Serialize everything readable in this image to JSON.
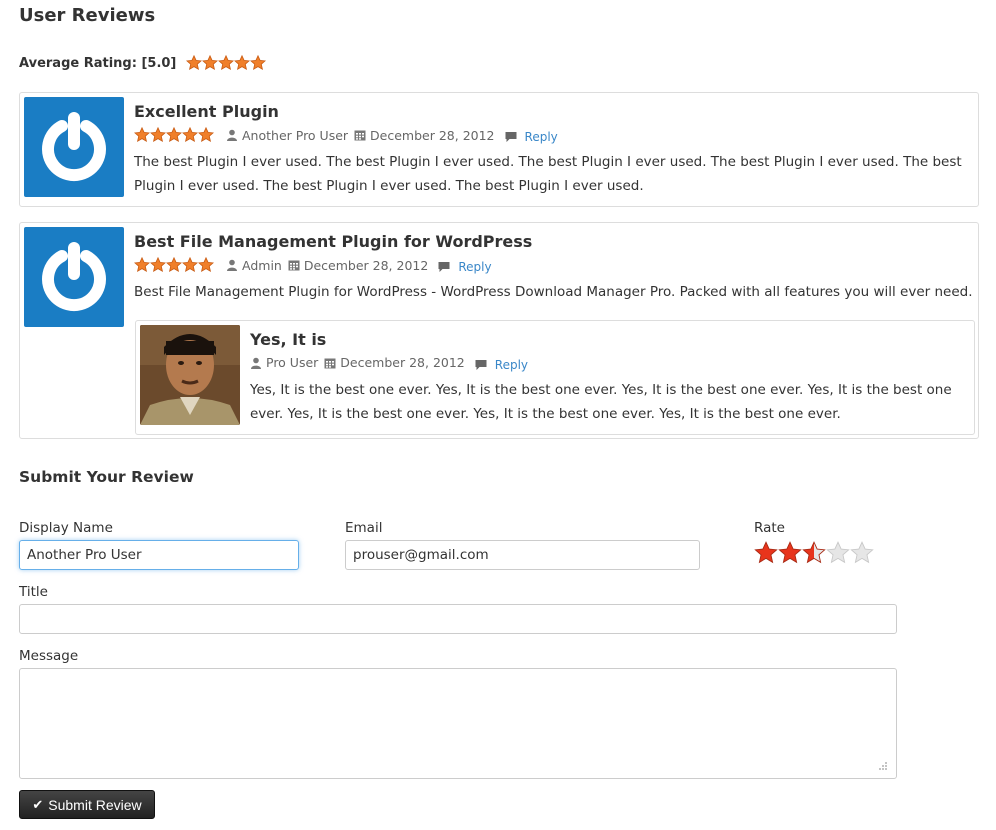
{
  "header": {
    "title": "User Reviews"
  },
  "average": {
    "label": "Average Rating: [5.0]",
    "rating": 5
  },
  "reviews": [
    {
      "title": "Excellent Plugin",
      "rating": 5,
      "author": "Another Pro User",
      "date": "December 28, 2012",
      "reply_label": "Reply",
      "body": "The best Plugin I ever used. The best Plugin I ever used. The best Plugin I ever used. The best Plugin I ever used. The best Plugin I ever used. The best Plugin I ever used. The best Plugin I ever used."
    },
    {
      "title": "Best File Management Plugin for WordPress",
      "rating": 5,
      "author": "Admin",
      "date": "December 28, 2012",
      "reply_label": "Reply",
      "body": "Best File Management Plugin for WordPress - WordPress Download Manager Pro. Packed with all features you will ever need.",
      "replies": [
        {
          "title": "Yes, It is",
          "author": "Pro User",
          "date": "December 28, 2012",
          "reply_label": "Reply",
          "body": "Yes, It is the best one ever. Yes, It is the best one ever. Yes, It is the best one ever. Yes, It is the best one ever. Yes, It is the best one ever. Yes, It is the best one ever. Yes, It is the best one ever."
        }
      ]
    }
  ],
  "form": {
    "title": "Submit Your Review",
    "display_name_label": "Display Name",
    "display_name_value": "Another Pro User",
    "email_label": "Email",
    "email_value": "prouser@gmail.com",
    "rate_label": "Rate",
    "rate_value": 2.5,
    "rate_max": 5,
    "title_label": "Title",
    "title_value": "",
    "message_label": "Message",
    "message_value": "",
    "submit_label": "Submit Review"
  },
  "colors": {
    "star_orange": "#f07f2a",
    "star_red": "#e8341c",
    "star_empty": "#e6e6e6",
    "avatar_blue": "#1a7dc4",
    "link_blue": "#3a87c8",
    "button_dark": "#333333"
  },
  "icons": {
    "author": "user-icon",
    "date": "calendar-icon",
    "reply": "comment-icon",
    "submit": "check-icon"
  }
}
